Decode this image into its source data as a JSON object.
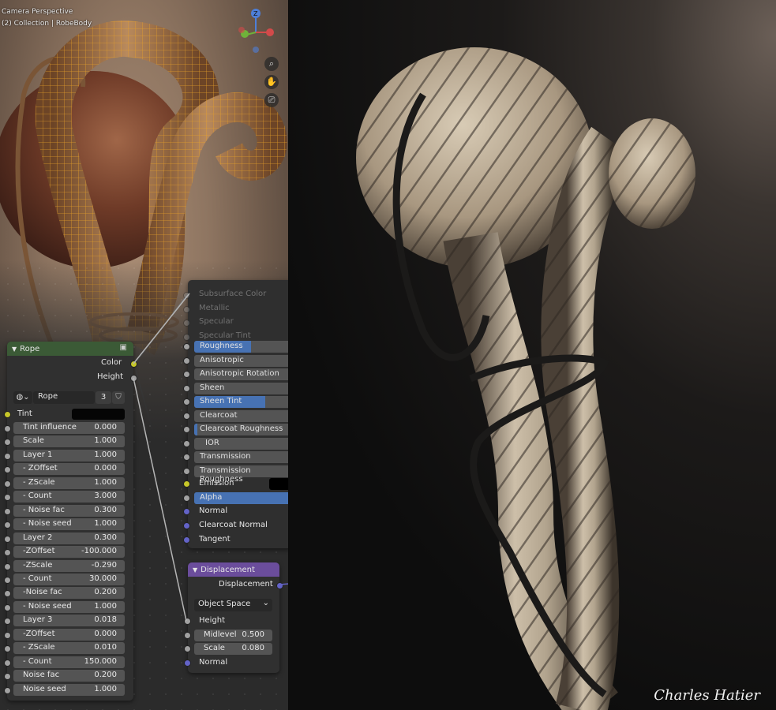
{
  "viewport": {
    "line1": "Camera Perspective",
    "line2": "(2) Collection | RobeBody",
    "gizmo_z": "Z",
    "icons": [
      "zoom-icon",
      "hand-icon",
      "camera-icon"
    ]
  },
  "rope_node": {
    "title": "Rope",
    "outputs": [
      "Color",
      "Height"
    ],
    "datablock_name": "Rope",
    "datablock_users": "3",
    "tint_label": "Tint",
    "tint_color": "#050505",
    "fields": [
      {
        "label": "Tint influence",
        "value": "0.000"
      },
      {
        "label": "Scale",
        "value": "1.000"
      },
      {
        "label": "Layer 1",
        "value": "1.000"
      },
      {
        "label": "- ZOffset",
        "value": "0.000"
      },
      {
        "label": "- ZScale",
        "value": "1.000"
      },
      {
        "label": "- Count",
        "value": "3.000"
      },
      {
        "label": "- Noise fac",
        "value": "0.300"
      },
      {
        "label": "- Noise seed",
        "value": "1.000"
      },
      {
        "label": "Layer 2",
        "value": "0.300"
      },
      {
        "label": "-ZOffset",
        "value": "-100.000"
      },
      {
        "label": "-ZScale",
        "value": "-0.290"
      },
      {
        "label": "- Count",
        "value": "30.000"
      },
      {
        "label": "-Noise fac",
        "value": "0.200"
      },
      {
        "label": "- Noise seed",
        "value": "1.000"
      },
      {
        "label": "Layer 3",
        "value": "0.018"
      },
      {
        "label": "-ZOffset",
        "value": "0.000"
      },
      {
        "label": "- ZScale",
        "value": "0.010"
      },
      {
        "label": "- Count",
        "value": "150.000"
      },
      {
        "label": "Noise fac",
        "value": "0.200"
      },
      {
        "label": "Noise seed",
        "value": "1.000"
      }
    ]
  },
  "bsdf_node": {
    "faded_rows": [
      "Subsurface Color",
      "Metallic",
      "Specular",
      "Specular Tint"
    ],
    "rows": [
      {
        "label": "Roughness",
        "fill": 0.6
      },
      {
        "label": "Anisotropic",
        "fill": 0
      },
      {
        "label": "Anisotropic Rotation",
        "fill": 0
      },
      {
        "label": "Sheen",
        "fill": 0
      },
      {
        "label": "Sheen Tint",
        "fill": 0.75
      },
      {
        "label": "Clearcoat",
        "fill": 0
      },
      {
        "label": "Clearcoat Roughness",
        "fill": 0.03
      },
      {
        "label": "IOR",
        "fill": 0
      },
      {
        "label": "Transmission",
        "fill": 0
      },
      {
        "label": "Transmission Roughness",
        "fill": 0
      }
    ],
    "emission_label": "Emission",
    "emission_color": "#000000",
    "alpha_label": "Alpha",
    "alpha_fill": 1.0,
    "vector_inputs": [
      "Normal",
      "Clearcoat Normal",
      "Tangent"
    ]
  },
  "displacement_node": {
    "title": "Displacement",
    "output": "Displacement",
    "space": "Object Space",
    "height_label": "Height",
    "midlevel_label": "Midlevel",
    "midlevel_value": "0.500",
    "scale_label": "Scale",
    "scale_value": "0.080",
    "normal_label": "Normal"
  },
  "render": {
    "signature": "Charles Hatier"
  }
}
